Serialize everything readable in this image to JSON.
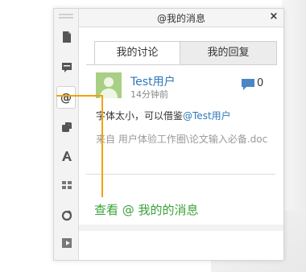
{
  "panel": {
    "title": "@我的消息",
    "close_symbol": "×"
  },
  "rail": {
    "icons": [
      "document-icon",
      "comment-icon",
      "mention-icon",
      "layers-icon",
      "text-style-icon",
      "grid-icon",
      "refresh-icon",
      "play-icon"
    ],
    "active": "mention-icon"
  },
  "tabs": [
    {
      "label": "我的讨论",
      "active": true
    },
    {
      "label": "我的回复",
      "active": false
    }
  ],
  "message": {
    "user": "Test用户",
    "time": "14分钟前",
    "comment_count": "0",
    "text_before": "字体太小，可以借鉴",
    "mention": "@Test用户",
    "source": "来自 用户体验工作圈\\论文输入必备.doc"
  },
  "annotation": {
    "label": "查看 @ 我的的消息"
  },
  "colors": {
    "accent_blue": "#2e78b8",
    "annotation_orange": "#f0a300",
    "annotation_green": "#3aa33a",
    "avatar_green": "#a9cf85"
  }
}
